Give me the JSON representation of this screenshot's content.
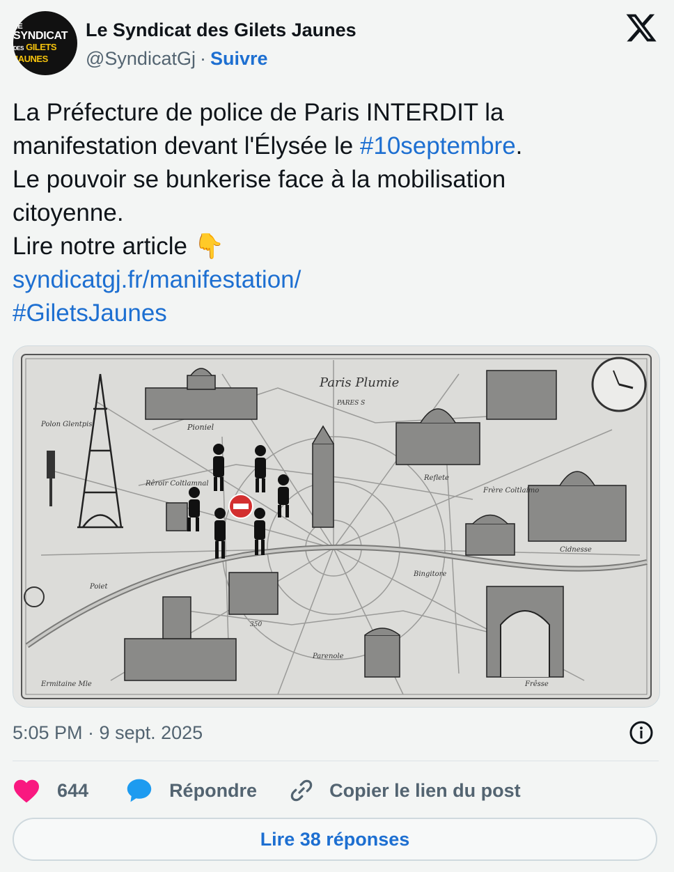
{
  "author": {
    "avatar_text_1a": "LE",
    "avatar_text_1b": "SYNDICAT",
    "avatar_text_2a": "DES",
    "avatar_text_2b": "GILETS JAUNES",
    "name": "Le Syndicat des Gilets Jaunes",
    "handle": "@SyndicatGj",
    "separator": "·",
    "follow_label": "Suivre"
  },
  "tweet": {
    "l1": "La Préfecture de police de Paris INTERDIT la",
    "l2_pre": "manifestation devant l'Élysée le ",
    "l2_tag": "#10septembre",
    "l2_post": ".",
    "l3": "Le pouvoir se bunkerise face à la mobilisation",
    "l4": "citoyenne.",
    "l5": "Lire notre article",
    "l5_emoji": "👇",
    "link": "syndicatgj.fr/manifestation/",
    "hashtag": "#GiletsJaunes"
  },
  "media": {
    "map_title": "Paris Plumie",
    "map_subtitle": "PARES S",
    "labels": [
      "Pioniel",
      "Rêroir Coltlamnal",
      "Poiet",
      "Reflete",
      "Frère Coltlaimo",
      "Bingitore",
      "Cidnesse",
      "Parenole",
      "Ermitaine Mle",
      "Frêsse",
      "Polon Glentpis",
      "350"
    ]
  },
  "timestamp": "5:05 PM · 9 sept. 2025",
  "actions": {
    "likes_count": "644",
    "reply_label": "Répondre",
    "copy_link_label": "Copier le lien du post"
  },
  "read_replies_label": "Lire 38 réponses",
  "colors": {
    "link": "#1d6fd1",
    "like": "#f91880",
    "reply_bubble": "#1d9bf0",
    "secondary_text": "#536471",
    "background": "#f3f5f4"
  },
  "icons": [
    "x-logo-icon",
    "pointing-down-emoji-icon",
    "info-icon",
    "heart-icon",
    "reply-bubble-icon",
    "link-icon"
  ]
}
